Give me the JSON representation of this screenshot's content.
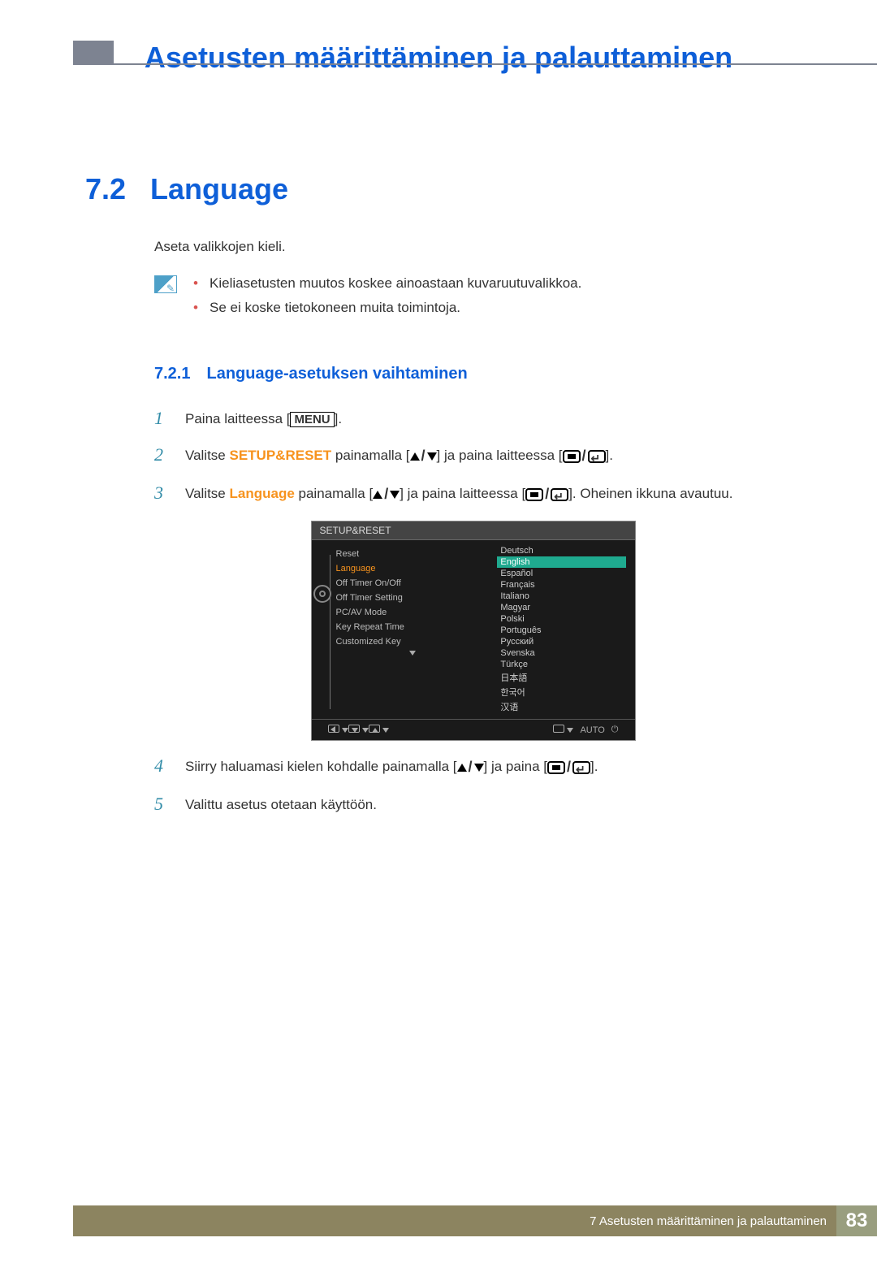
{
  "header": {
    "page_title": "Asetusten määrittäminen ja palauttaminen"
  },
  "section": {
    "number": "7.2",
    "title": "Language",
    "intro": "Aseta valikkojen kieli.",
    "notes": [
      "Kieliasetusten muutos koskee ainoastaan kuvaruutuvalikkoa.",
      "Se ei koske tietokoneen muita toimintoja."
    ]
  },
  "subsection": {
    "number": "7.2.1",
    "title": "Language-asetuksen vaihtaminen"
  },
  "steps": {
    "s1_prefix": "Paina laitteessa [",
    "s1_menu": "MENU",
    "s1_suffix": "].",
    "s2_a": "Valitse ",
    "s2_bold": "SETUP&RESET",
    "s2_b": " painamalla [",
    "s2_c": "] ja paina laitteessa [",
    "s2_d": "].",
    "s3_a": "Valitse ",
    "s3_bold": "Language",
    "s3_b": " painamalla [",
    "s3_c": "] ja paina laitteessa [",
    "s3_d": "]. Oheinen ikkuna avautuu.",
    "s4_a": "Siirry haluamasi kielen kohdalle painamalla [",
    "s4_b": "] ja paina [",
    "s4_c": "].",
    "s5": "Valittu asetus otetaan käyttöön."
  },
  "osd": {
    "title": "SETUP&RESET",
    "left_items": [
      "Reset",
      "Language",
      "Off Timer On/Off",
      "Off Timer Setting",
      "PC/AV Mode",
      "Key Repeat Time",
      "Customized Key"
    ],
    "languages": [
      "Deutsch",
      "English",
      "Español",
      "Français",
      "Italiano",
      "Magyar",
      "Polski",
      "Português",
      "Русский",
      "Svenska",
      "Türkçe",
      "日本語",
      "한국어",
      "汉语"
    ],
    "selected_language": "English",
    "bottom_auto": "AUTO"
  },
  "footer": {
    "text": "7 Asetusten määrittäminen ja palauttaminen",
    "page_number": "83"
  }
}
